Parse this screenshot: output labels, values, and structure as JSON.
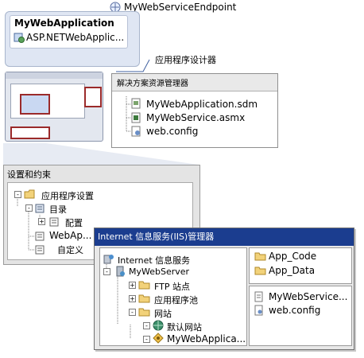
{
  "endpoint": {
    "label": "MyWebServiceEndpoint"
  },
  "app_card": {
    "title": "MyWebApplication",
    "subtitle": "ASP.NETWebApplic..."
  },
  "designer_callout": "应用程序设计器",
  "solution_explorer": {
    "title": "解决方案资源管理器",
    "items": [
      {
        "label": "MyWebApplication.sdm",
        "icon": "sdm-file-icon"
      },
      {
        "label": "MyWebService.asmx",
        "icon": "asmx-file-icon"
      },
      {
        "label": "web.config",
        "icon": "config-file-icon"
      }
    ]
  },
  "settings": {
    "title": "设置和约束",
    "tree": [
      {
        "label": "应用程序设置",
        "level": 0
      },
      {
        "label": "目录",
        "level": 1
      },
      {
        "label": "配置",
        "level": 2
      },
      {
        "label": "WebAp...",
        "level": 1
      },
      {
        "label": "自定义",
        "level": 1
      }
    ]
  },
  "iis": {
    "title": "Internet 信息服务(IIS)管理器",
    "tree": [
      {
        "label": "Internet 信息服务"
      },
      {
        "label": "MyWebServer"
      },
      {
        "label": "FTP 站点"
      },
      {
        "label": "应用程序池"
      },
      {
        "label": "网站"
      },
      {
        "label": "默认网站"
      },
      {
        "label": "MyWebApplica..."
      }
    ],
    "folders": [
      "App_Code",
      "App_Data"
    ],
    "files": [
      "MyWebService...",
      "web.config"
    ]
  }
}
